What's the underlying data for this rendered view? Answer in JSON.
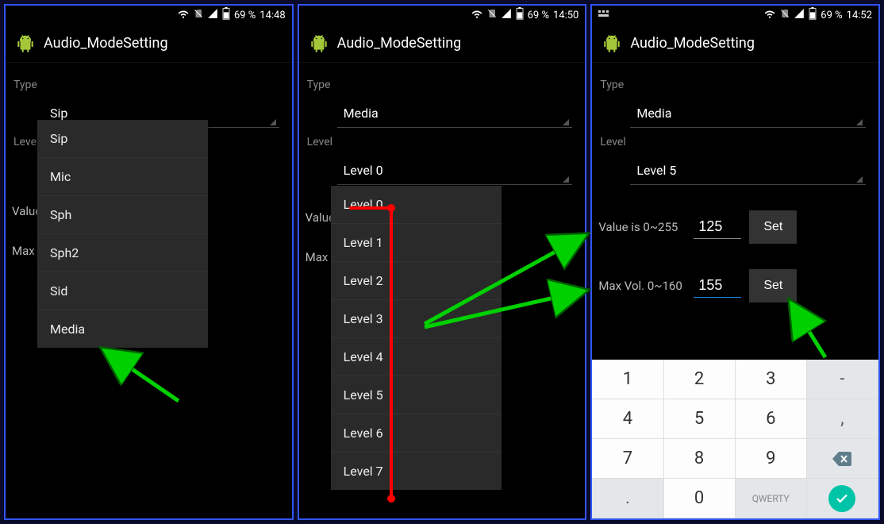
{
  "screens": [
    {
      "status": {
        "battery_pct": "69 %",
        "time": "14:48"
      },
      "title": "Audio_ModeSetting",
      "type_label": "Type",
      "type_value": "Sip",
      "level_label": "Level",
      "value_label": "Value",
      "maxvol_label": "Max V",
      "dropdown_open": "type",
      "type_options": [
        "Sip",
        "Mic",
        "Sph",
        "Sph2",
        "Sid",
        "Media"
      ]
    },
    {
      "status": {
        "battery_pct": "69 %",
        "time": "14:50"
      },
      "title": "Audio_ModeSetting",
      "type_label": "Type",
      "type_value": "Media",
      "level_label": "Level",
      "level_value": "Level 0",
      "value_label": "Value",
      "maxvol_label": "Max V",
      "dropdown_open": "level",
      "level_options": [
        "Level 0",
        "Level 1",
        "Level 2",
        "Level 3",
        "Level 4",
        "Level 5",
        "Level 6",
        "Level 7"
      ]
    },
    {
      "status": {
        "battery_pct": "69 %",
        "time": "14:52"
      },
      "title": "Audio_ModeSetting",
      "type_label": "Type",
      "type_value": "Media",
      "level_label": "Level",
      "level_value": "Level 5",
      "value_label": "Value is 0~255",
      "value_input": "125",
      "maxvol_label": "Max Vol. 0~160",
      "maxvol_input": "155",
      "set_label": "Set",
      "keypad": {
        "rows": [
          [
            "1",
            "2",
            "3",
            "-"
          ],
          [
            "4",
            "5",
            "6",
            ","
          ],
          [
            "7",
            "8",
            "9",
            "⌫"
          ],
          [
            ".",
            "0",
            "QWERTY",
            "✓"
          ]
        ]
      }
    }
  ]
}
